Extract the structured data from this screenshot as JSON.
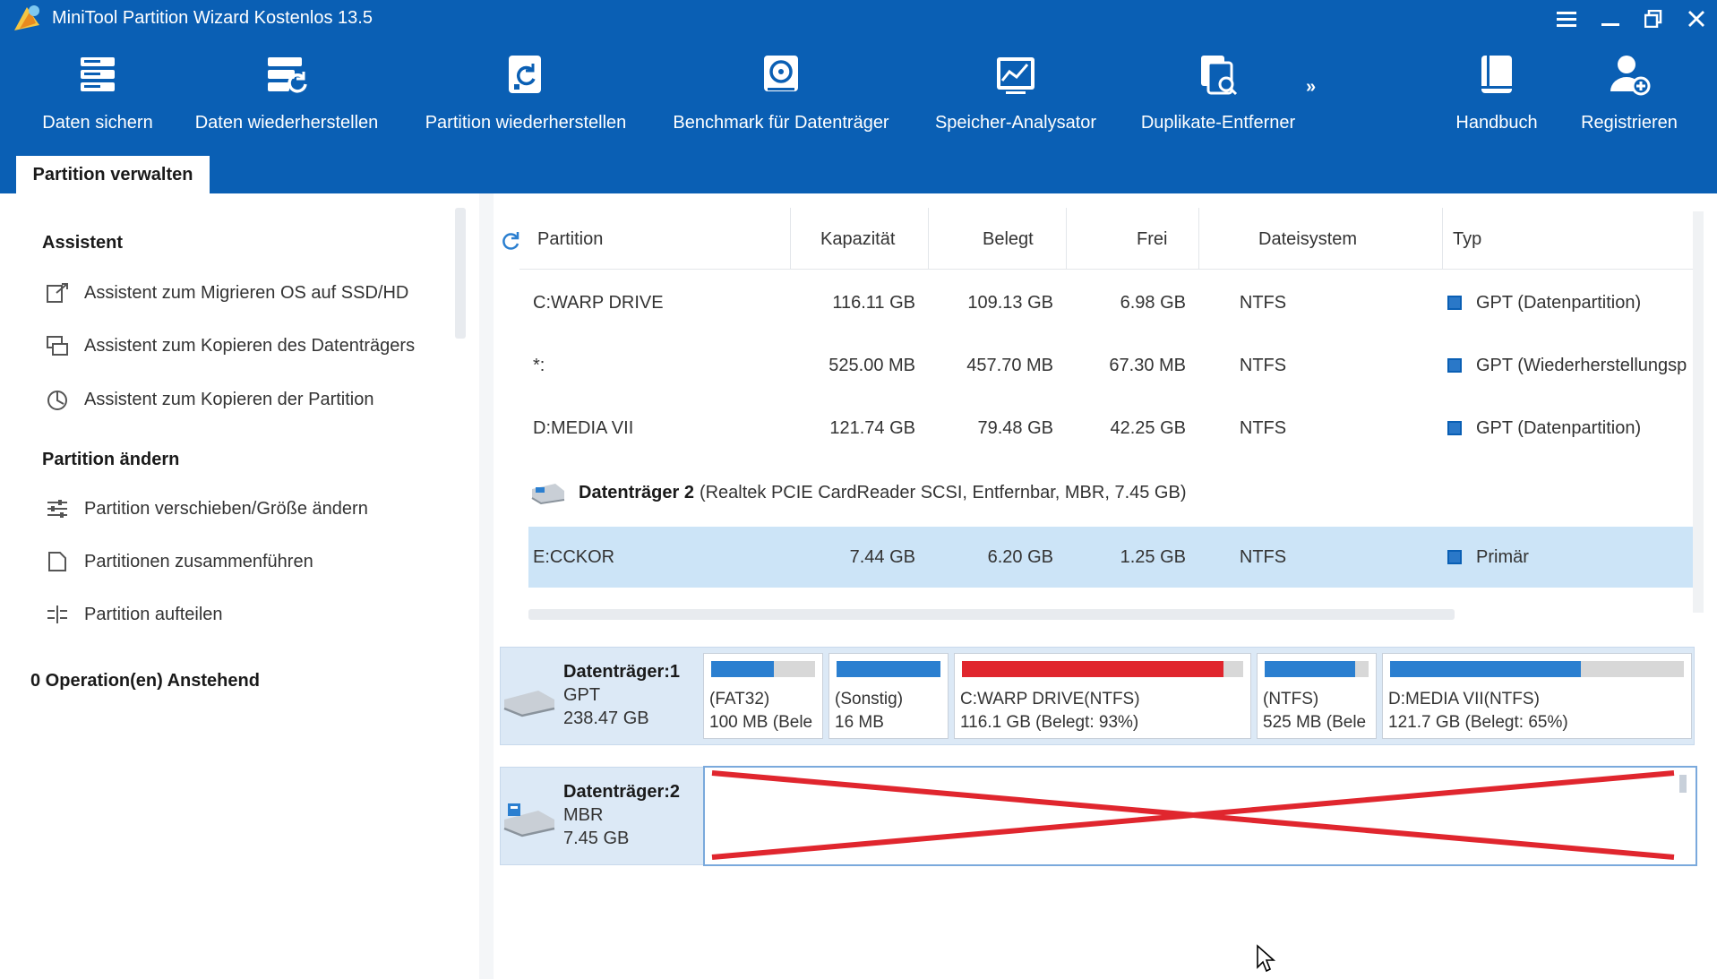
{
  "window": {
    "title": "MiniTool Partition Wizard Kostenlos 13.5"
  },
  "toolbar": {
    "items": [
      {
        "label": "Daten sichern",
        "icon": "backup-icon"
      },
      {
        "label": "Daten wiederherstellen",
        "icon": "data-recovery-icon"
      },
      {
        "label": "Partition wiederherstellen",
        "icon": "partition-recovery-icon"
      },
      {
        "label": "Benchmark für Datenträger",
        "icon": "disk-benchmark-icon"
      },
      {
        "label": "Speicher-Analysator",
        "icon": "space-analyzer-icon"
      },
      {
        "label": "Duplikate-Entferner",
        "icon": "duplicate-finder-icon"
      },
      {
        "label": "Handbuch",
        "icon": "manual-icon"
      },
      {
        "label": "Registrieren",
        "icon": "register-icon"
      }
    ],
    "more": "»"
  },
  "tabs": {
    "active": "Partition verwalten"
  },
  "sidebar": {
    "section1": "Assistent",
    "wizard_items": [
      "Assistent zum Migrieren OS auf SSD/HD",
      "Assistent zum Kopieren des Datenträgers",
      "Assistent zum Kopieren der Partition"
    ],
    "section2": "Partition ändern",
    "change_items": [
      "Partition verschieben/Größe ändern",
      "Partitionen zusammenführen",
      "Partition aufteilen"
    ],
    "pending": "0 Operation(en) Anstehend"
  },
  "table": {
    "headers": {
      "partition": "Partition",
      "capacity": "Kapazität",
      "used": "Belegt",
      "free": "Frei",
      "filesystem": "Dateisystem",
      "type": "Typ"
    },
    "rows": [
      {
        "partition": "C:WARP DRIVE",
        "capacity": "116.11 GB",
        "used": "109.13 GB",
        "free": "6.98 GB",
        "fs": "NTFS",
        "type": "GPT (Datenpartition)"
      },
      {
        "partition": "*:",
        "capacity": "525.00 MB",
        "used": "457.70 MB",
        "free": "67.30 MB",
        "fs": "NTFS",
        "type": "GPT (Wiederherstellungsp"
      },
      {
        "partition": "D:MEDIA VII",
        "capacity": "121.74 GB",
        "used": "79.48 GB",
        "free": "42.25 GB",
        "fs": "NTFS",
        "type": "GPT (Datenpartition)"
      }
    ],
    "disk2": {
      "name": "Datenträger 2",
      "details": "(Realtek PCIE CardReader SCSI, Entfernbar, MBR, 7.45 GB)"
    },
    "selected_row": {
      "partition": "E:CCKOR",
      "capacity": "7.44 GB",
      "used": "6.20 GB",
      "free": "1.25 GB",
      "fs": "NTFS",
      "type": "Primär"
    }
  },
  "diskmap": {
    "disk1": {
      "name": "Datenträger:1",
      "scheme": "GPT",
      "size": "238.47 GB",
      "partitions": [
        {
          "line1": "(FAT32)",
          "line2": "100 MB (Bele",
          "used_fraction": 0.6,
          "color": "#2b7fd0"
        },
        {
          "line1": "(Sonstig)",
          "line2": "16 MB",
          "used_fraction": 1.0,
          "color": "#2b7fd0"
        },
        {
          "line1": "C:WARP DRIVE(NTFS)",
          "line2": "116.1 GB (Belegt: 93%)",
          "used_fraction": 0.93,
          "color": "#e0262e"
        },
        {
          "line1": "(NTFS)",
          "line2": "525 MB (Bele",
          "used_fraction": 0.87,
          "color": "#2b7fd0"
        },
        {
          "line1": "D:MEDIA VII(NTFS)",
          "line2": "121.7 GB (Belegt: 65%)",
          "used_fraction": 0.65,
          "color": "#2b7fd0"
        }
      ]
    },
    "disk2": {
      "name": "Datenträger:2",
      "scheme": "MBR",
      "size": "7.45 GB",
      "cross_color": "#e0262e"
    }
  }
}
